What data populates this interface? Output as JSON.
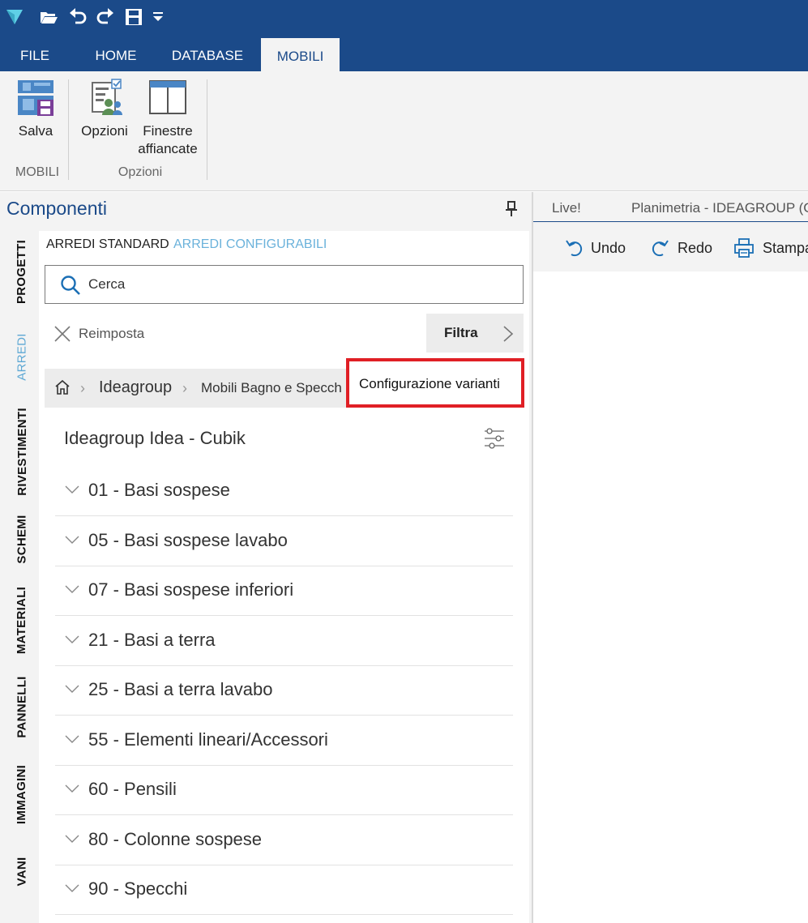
{
  "quick_access": {
    "icons": [
      "app-logo-icon",
      "open-folder-icon",
      "undo-icon",
      "redo-icon",
      "save-icon",
      "customize-dropdown-icon"
    ]
  },
  "ribbon_tabs": [
    "FILE",
    "HOME",
    "DATABASE",
    "MOBILI"
  ],
  "ribbon_tab_active": "MOBILI",
  "ribbon": {
    "save_label": "Salva",
    "group_mobili_label": "MOBILI",
    "options_label": "Opzioni",
    "tiled_windows_line1": "Finestre",
    "tiled_windows_line2": "affiancate",
    "group_options_label": "Opzioni"
  },
  "panel": {
    "title": "Componenti",
    "vertical_tabs": [
      "PROGETTI",
      "ARREDI",
      "RIVESTIMENTI",
      "SCHEMI",
      "MATERIALI",
      "PANNELLI",
      "IMMAGINI",
      "VANI"
    ],
    "active_vertical_tab": "ARREDI",
    "sub_tabs": [
      "ARREDI STANDARD",
      "ARREDI CONFIGURABILI"
    ],
    "search_placeholder": "Cerca",
    "reset_label": "Reimposta",
    "filter_label": "Filtra",
    "breadcrumb": [
      "Ideagroup",
      "Mobili Bagno e Specch"
    ],
    "tooltip": "Configurazione varianti",
    "category_title": "Ideagroup Idea - Cubik",
    "items": [
      "01 - Basi sospese",
      "05 - Basi sospese lavabo",
      "07 - Basi sospese inferiori",
      "21 - Basi a terra",
      "25 - Basi a terra lavabo",
      "55 - Elementi lineari/Accessori",
      "60 - Pensili",
      "80 - Colonne sospese",
      "90 - Specchi"
    ]
  },
  "document": {
    "tabs": [
      "Live!",
      "Planimetria - IDEAGROUP (C"
    ],
    "toolbar": {
      "undo": "Undo",
      "redo": "Redo",
      "print": "Stampa"
    }
  },
  "colors": {
    "title_bar": "#1b4a89",
    "accent_blue": "#1b4a89",
    "active_tab_text": "#5ea8d4",
    "highlight_border": "#e01f25",
    "panel_background": "#f3f3f3"
  }
}
